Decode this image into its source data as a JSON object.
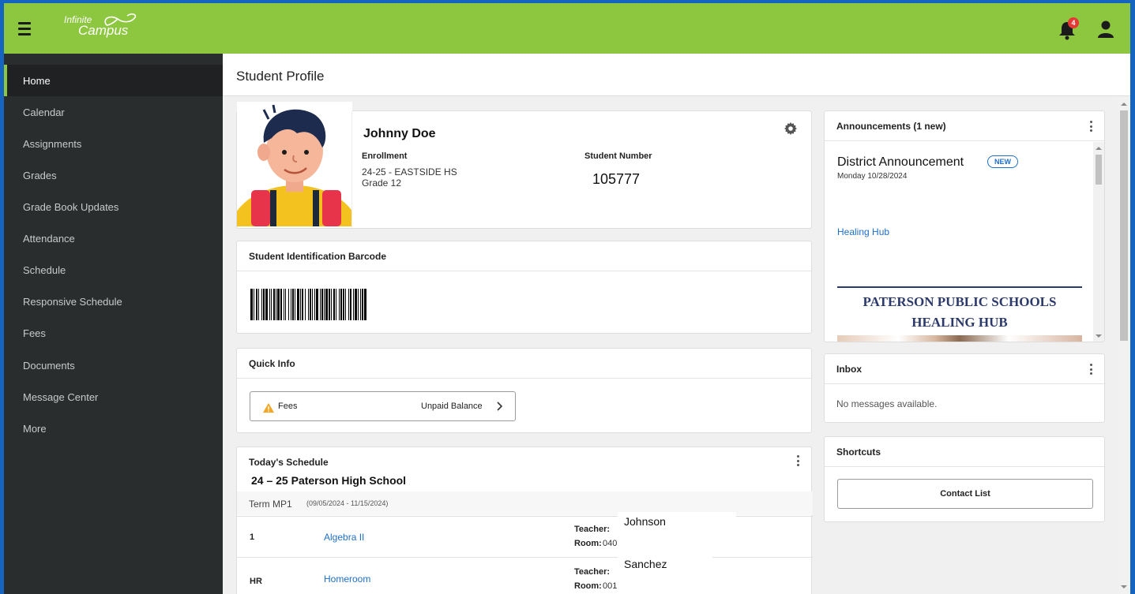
{
  "app": {
    "logo_line1": "Infinite",
    "logo_line2": "Campus"
  },
  "topbar": {
    "notification_count": "4"
  },
  "sidebar": {
    "items": [
      {
        "label": "Home",
        "active": true
      },
      {
        "label": "Calendar"
      },
      {
        "label": "Assignments"
      },
      {
        "label": "Grades"
      },
      {
        "label": "Grade Book Updates"
      },
      {
        "label": "Attendance"
      },
      {
        "label": "Schedule"
      },
      {
        "label": "Responsive Schedule"
      },
      {
        "label": "Fees"
      },
      {
        "label": "Documents"
      },
      {
        "label": "Message Center"
      },
      {
        "label": "More"
      }
    ]
  },
  "page": {
    "title": "Student Profile"
  },
  "profile": {
    "name": "Johnny Doe",
    "enrollment_label": "Enrollment",
    "enrollment_line1": "24-25 - EASTSIDE HS",
    "enrollment_line2": "Grade 12",
    "student_number_label": "Student Number",
    "student_number": "105777"
  },
  "barcode": {
    "title": "Student Identification Barcode"
  },
  "quick_info": {
    "title": "Quick Info",
    "fees_label": "Fees",
    "fees_status": "Unpaid Balance"
  },
  "schedule": {
    "title": "Today's Schedule",
    "school": "24 – 25 Paterson High School",
    "term": "Term MP1",
    "term_dates": "(09/05/2024 - 11/15/2024)",
    "teacher_label": "Teacher:",
    "room_label": "Room:",
    "rows": [
      {
        "period": "1",
        "course": "Algebra II",
        "teacher": "Johnson",
        "room": "040"
      },
      {
        "period": "HR",
        "course": "Homeroom",
        "teacher": "Sanchez",
        "room": "001"
      }
    ]
  },
  "announcements": {
    "title": "Announcements (1 new)",
    "item_title": "District Announcement",
    "new_badge": "NEW",
    "date": "Monday 10/28/2024",
    "link": "Healing Hub",
    "banner_line1": "PATERSON PUBLIC SCHOOLS",
    "banner_line2": "HEALING HUB"
  },
  "inbox": {
    "title": "Inbox",
    "empty_text": "No messages available."
  },
  "shortcuts": {
    "title": "Shortcuts",
    "contact_list": "Contact List"
  },
  "colors": {
    "brand_green": "#8dc63f",
    "sidebar": "#2a2d2e",
    "link": "#1e6fc9",
    "frame_blue": "#1565c0"
  }
}
